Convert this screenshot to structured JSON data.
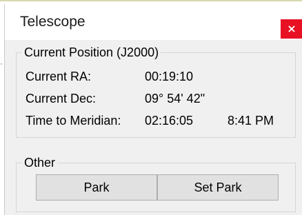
{
  "window": {
    "title": "Telescope",
    "close_glyph": "×",
    "accent_close": "#e81123"
  },
  "current_position": {
    "group_title": "Current Position (J2000)",
    "rows": [
      {
        "label": "Current RA:",
        "value": "00:19:10",
        "extra": ""
      },
      {
        "label": "Current Dec:",
        "value": "09° 54' 42\"",
        "extra": ""
      },
      {
        "label": "Time to Meridian:",
        "value": "02:16:05",
        "extra": "8:41 PM"
      }
    ]
  },
  "other": {
    "group_title": "Other",
    "park_label": "Park",
    "set_park_label": "Set Park"
  }
}
